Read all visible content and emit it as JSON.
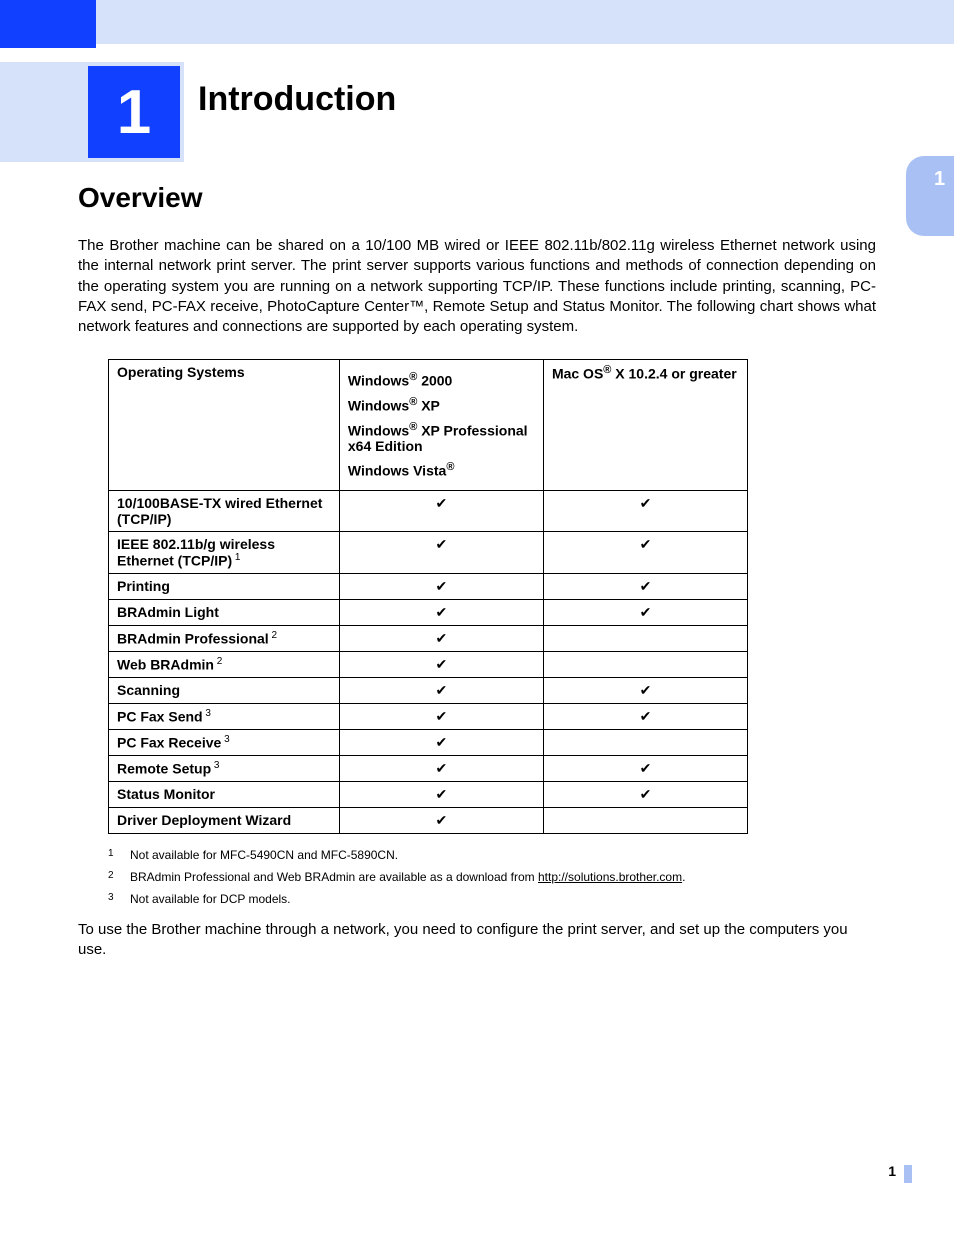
{
  "chapter": {
    "number": "1",
    "title": "Introduction"
  },
  "side_tab": "1",
  "section_heading": "Overview",
  "intro_paragraph": "The Brother machine can be shared on a 10/100 MB wired or IEEE 802.11b/802.11g wireless Ethernet network using the internal network print server. The print server supports various functions and methods of connection depending on the operating system you are running on a network supporting TCP/IP. These functions include printing, scanning, PC-FAX send, PC-FAX receive, PhotoCapture Center™, Remote Setup and Status Monitor. The following chart shows what network features and connections are supported by each operating system.",
  "table": {
    "header": {
      "col1": "Operating Systems",
      "col2": {
        "lines": [
          {
            "pre": "Windows",
            "reg": "®",
            "post": " 2000"
          },
          {
            "pre": "Windows",
            "reg": "®",
            "post": " XP"
          },
          {
            "pre": "Windows",
            "reg": "®",
            "post": " XP Professional x64 Edition"
          },
          {
            "pre": "Windows Vista",
            "reg": "®",
            "post": ""
          }
        ]
      },
      "col3": {
        "pre": "Mac OS",
        "reg": "®",
        "post": " X 10.2.4 or greater"
      }
    },
    "rows": [
      {
        "label": "10/100BASE-TX wired Ethernet (TCP/IP)",
        "sup": "",
        "win": "✔",
        "mac": "✔"
      },
      {
        "label": "IEEE 802.11b/g wireless Ethernet (TCP/IP)",
        "sup": "1",
        "win": "✔",
        "mac": "✔"
      },
      {
        "label": "Printing",
        "sup": "",
        "win": "✔",
        "mac": "✔"
      },
      {
        "label": "BRAdmin Light",
        "sup": "",
        "win": "✔",
        "mac": "✔"
      },
      {
        "label": "BRAdmin Professional",
        "sup": "2",
        "win": "✔",
        "mac": ""
      },
      {
        "label": "Web BRAdmin",
        "sup": "2",
        "win": "✔",
        "mac": ""
      },
      {
        "label": "Scanning",
        "sup": "",
        "win": "✔",
        "mac": "✔"
      },
      {
        "label": "PC Fax Send",
        "sup": "3",
        "win": "✔",
        "mac": "✔"
      },
      {
        "label": "PC Fax Receive",
        "sup": "3",
        "win": "✔",
        "mac": ""
      },
      {
        "label": "Remote Setup",
        "sup": "3",
        "win": "✔",
        "mac": "✔"
      },
      {
        "label": "Status Monitor",
        "sup": "",
        "win": "✔",
        "mac": "✔"
      },
      {
        "label": "Driver Deployment Wizard",
        "sup": "",
        "win": "✔",
        "mac": ""
      }
    ]
  },
  "footnotes": [
    {
      "num": "1",
      "text": "Not available for MFC-5490CN and MFC-5890CN.",
      "link": ""
    },
    {
      "num": "2",
      "text": "BRAdmin Professional and Web BRAdmin are available as a download from ",
      "link": "http://solutions.brother.com",
      "after": "."
    },
    {
      "num": "3",
      "text": "Not available for DCP models.",
      "link": ""
    }
  ],
  "closing_paragraph": "To use the Brother machine through a network, you need to configure the print server, and set up the computers you use.",
  "page_number": "1"
}
